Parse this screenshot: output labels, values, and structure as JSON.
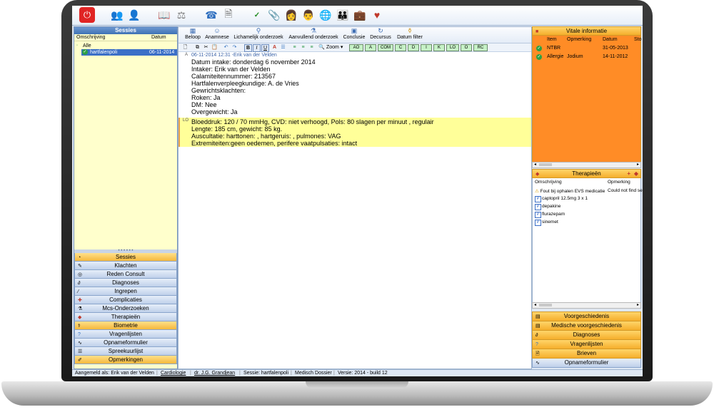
{
  "toolbar": {
    "icons": [
      "power-icon",
      "users-icon",
      "person-edit-icon",
      "book-icon",
      "scale-icon",
      "phone-book-icon",
      "document-icon",
      "spellcheck-icon",
      "paperclip-icon",
      "nurse-icon",
      "doctor-icon",
      "globe-icon",
      "group-icon",
      "bag-icon",
      "heart-icon"
    ]
  },
  "sessions": {
    "title": "Sessies",
    "col_description": "Omschrijving",
    "col_date": "Datum",
    "rows": [
      {
        "label": "Alle",
        "date": ""
      },
      {
        "label": "hartfalenpoli",
        "date": "06-11-2014"
      }
    ]
  },
  "left_nav": [
    "Sessies",
    "Klachten",
    "Reden Consult",
    "Diagnoses",
    "Ingrepen",
    "Complicaties",
    "Mcs-Onderzoeken",
    "Therapieën",
    "Biometrie",
    "Vragenlijsten",
    "Opnameformulier",
    "Spreekuurlijst",
    "Opmerkingen"
  ],
  "actions": [
    "Beloop",
    "Anamnese",
    "Lichamelijk onderzoek",
    "Aanvullend onderzoek",
    "Conclusie",
    "Decursus",
    "Datum filter"
  ],
  "format": {
    "zoom_label": "Zoom",
    "tags": [
      "AO",
      "A",
      "COM",
      "C",
      "D",
      "I",
      "K",
      "LO",
      "O",
      "RC"
    ]
  },
  "note": {
    "a_marker": "A",
    "header": "06-11-2014 12:31 -Erik van der Velden",
    "lines": [
      "Datum intake:  donderdag 6 november 2014",
      "Intaker:  Erik van der Velden",
      "Calamiteitennummer:  213567",
      "Hartfalenverpleegkundige:  A. de Vries",
      "Gewrichtsklachten:",
      "Roken: Ja",
      "DM: Nee",
      "Overgewicht: Ja"
    ],
    "lo_marker": "LO",
    "lo_lines": [
      "Bloeddruk: 120 / 70 mmHg, CVD: niet verhoogd, Pols: 80 slagen per minuut , regulair",
      "Lengte: 185 cm, gewicht: 85 kg.",
      "Auscultatie: harttonen: , hartgeruis: , pulmones: VAG",
      "Extremiteiten:geen oedemen, perifere vaatpulsaties: intact"
    ]
  },
  "vital": {
    "title": "Vitale informatie",
    "col_item": "Item",
    "col_remark": "Opmerking",
    "col_date": "Datum",
    "col_extra": "Sto",
    "rows": [
      {
        "item": "NTBR",
        "remark": "",
        "date": "31-05-2013"
      },
      {
        "item": "Allergie",
        "remark": "Jodium",
        "date": "14-11-2012"
      }
    ]
  },
  "therapies": {
    "title": "Therapieën",
    "col_description": "Omschrijving",
    "col_remark": "Opmerking",
    "warning_text": "Fout bij ophalen EVS medicatie",
    "warning_remark": "Could not find se",
    "items": [
      "captopril 12.5mg 3 x 1",
      "depakine",
      "flurazepam",
      "sinemet"
    ]
  },
  "right_nav": [
    "Voorgeschiedenis",
    "Medische voorgeschiedenis",
    "Diagnoses",
    "Vragenlijsten",
    "Brieven",
    "Opnameformulier"
  ],
  "status": {
    "logged_in": "Aangemeld als: Erik van der Velden",
    "department": "Cardiologie",
    "doctor": "dr. J.G. Grandjean",
    "session": "Sessie: hartfalenpoli",
    "record": "Medisch Dossier",
    "version": "Versie: 2014 - build 12"
  },
  "colors": {
    "vital_bg": "#ff8c26",
    "session_bg": "#ffffcc",
    "note_highlight": "#ffff99",
    "selected": "#3b6fc7"
  }
}
